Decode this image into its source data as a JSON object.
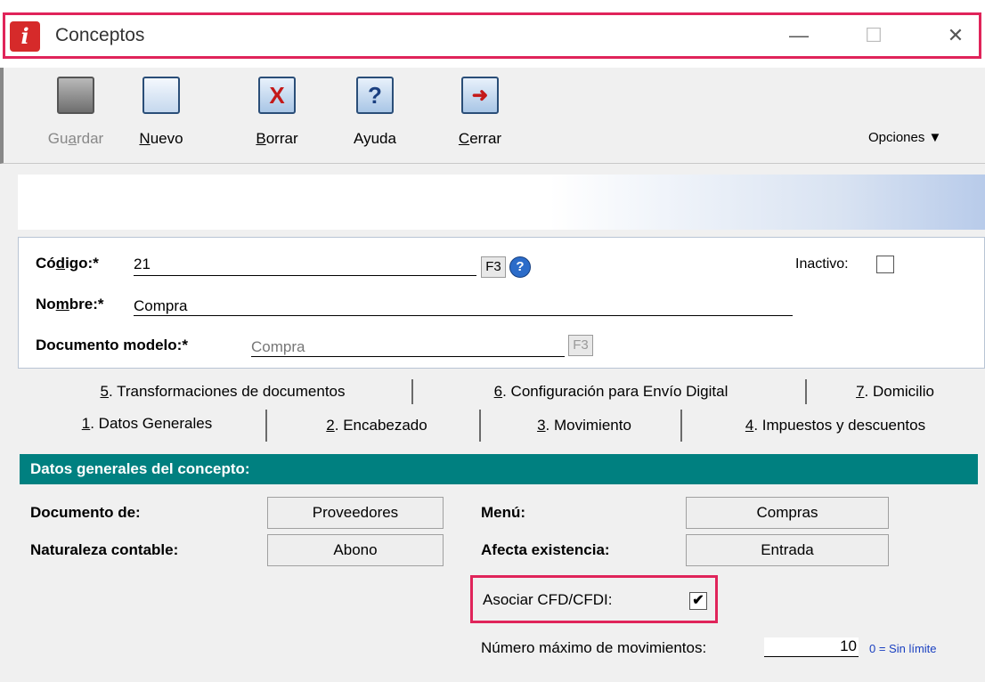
{
  "window": {
    "title": "Conceptos",
    "icon_letter": "i",
    "minimize": "—",
    "maximize": "☐",
    "close": "✕"
  },
  "toolbar": {
    "items": [
      {
        "pre": "Gu",
        "ul": "a",
        "post": "rdar",
        "icon": "save-icon",
        "glyph": ""
      },
      {
        "pre": "",
        "ul": "N",
        "post": "uevo",
        "icon": "new-document-icon",
        "glyph": ""
      },
      {
        "pre": "",
        "ul": "B",
        "post": "orrar",
        "icon": "delete-icon",
        "glyph": "X"
      },
      {
        "pre": "Ayuda",
        "ul": "",
        "post": "",
        "icon": "help-icon",
        "glyph": "?"
      },
      {
        "pre": "",
        "ul": "C",
        "post": "errar",
        "icon": "exit-icon",
        "glyph": "➜"
      }
    ],
    "options_label": "Opciones ▼"
  },
  "header": {
    "codigo_pre": "Có",
    "codigo_ul": "d",
    "codigo_post": "igo:*",
    "codigo_value": "21",
    "f3": "F3",
    "help_glyph": "?",
    "inactivo_label": "Inactivo:",
    "nombre_pre": "No",
    "nombre_ul": "m",
    "nombre_post": "bre:*",
    "nombre_value": "Compra",
    "documento_label": "Documento modelo:*",
    "documento_value": "Compra"
  },
  "tabs": {
    "row1": [
      {
        "ul": "5",
        "rest": ". Transformaciones de documentos"
      },
      {
        "ul": "6",
        "rest": ". Configuración para Envío Digital"
      },
      {
        "ul": "7",
        "rest": ". Domicilio"
      }
    ],
    "row2": [
      {
        "ul": "1",
        "rest": ". Datos Generales"
      },
      {
        "ul": "2",
        "rest": ". Encabezado"
      },
      {
        "ul": "3",
        "rest": ". Movimiento"
      },
      {
        "ul": "4",
        "rest": ". Impuestos y descuentos"
      }
    ]
  },
  "content": {
    "section_title": "Datos generales del concepto:",
    "documento_de_label": "Documento de:",
    "documento_de_value": "Proveedores",
    "menu_label": "Menú:",
    "menu_value": "Compras",
    "naturaleza_label": "Naturaleza contable:",
    "naturaleza_value": "Abono",
    "afecta_label": "Afecta existencia:",
    "afecta_value": "Entrada",
    "asociar_label": "Asociar CFD/CFDI:",
    "asociar_checked": "✔",
    "max_mov_label": "Número máximo de movimientos:",
    "max_mov_value": "10",
    "max_mov_hint": "0 = Sin límite"
  },
  "colors": {
    "accent_highlight": "#e0245a",
    "section_header": "#008080"
  }
}
